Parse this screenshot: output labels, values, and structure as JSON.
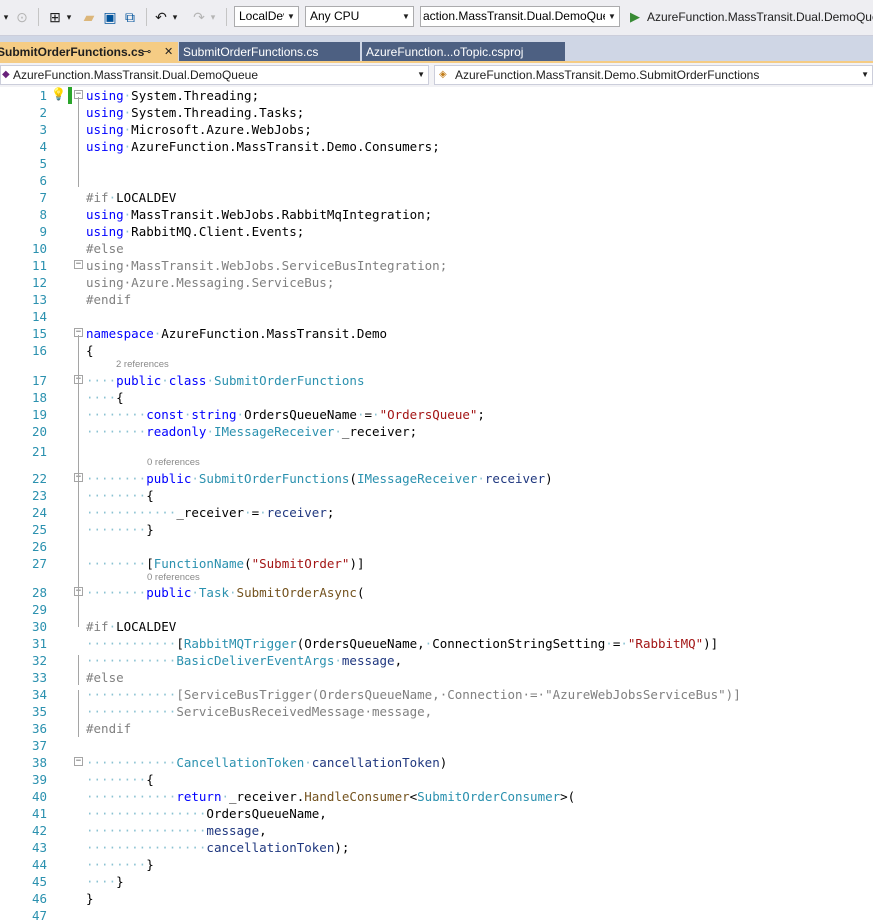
{
  "toolbar": {
    "config_value": "LocalDev",
    "platform_value": "Any CPU",
    "startup_project_value": "action.MassTransit.Dual.DemoQueue",
    "run_target_label": "AzureFunction.MassTransit.Dual.DemoQueue"
  },
  "tabs": [
    {
      "label": "SubmitOrderFunctions.cs",
      "pin": "⊸",
      "close": "✕"
    },
    {
      "label": "SubmitOrderFunctions.cs"
    },
    {
      "label": "AzureFunction...oTopic.csproj"
    }
  ],
  "navbar": {
    "project": "AzureFunction.MassTransit.Dual.DemoQueue",
    "type": "AzureFunction.MassTransit.Demo.SubmitOrderFunctions"
  },
  "lens": {
    "class_refs": "2 references",
    "ctor_refs": "0 references",
    "method_refs": "0 references"
  },
  "code_lines": [
    {
      "n": "1",
      "segs": [
        [
          "kw",
          "using"
        ],
        [
          "ws",
          "·"
        ],
        [
          "",
          "System.Threading;"
        ]
      ]
    },
    {
      "n": "2",
      "segs": [
        [
          "kw",
          "using"
        ],
        [
          "ws",
          "·"
        ],
        [
          "",
          "System.Threading.Tasks;"
        ]
      ]
    },
    {
      "n": "3",
      "segs": [
        [
          "kw",
          "using"
        ],
        [
          "ws",
          "·"
        ],
        [
          "",
          "Microsoft.Azure.WebJobs;"
        ]
      ]
    },
    {
      "n": "4",
      "segs": [
        [
          "kw",
          "using"
        ],
        [
          "ws",
          "·"
        ],
        [
          "",
          "AzureFunction.MassTransit.Demo.Consumers;"
        ]
      ]
    },
    {
      "n": "5",
      "segs": []
    },
    {
      "n": "6",
      "segs": []
    },
    {
      "n": "7",
      "segs": [
        [
          "pp",
          "#if"
        ],
        [
          "ws",
          "·"
        ],
        [
          "",
          "LOCALDEV"
        ]
      ]
    },
    {
      "n": "8",
      "segs": [
        [
          "kw",
          "using"
        ],
        [
          "ws",
          "·"
        ],
        [
          "",
          "MassTransit.WebJobs.RabbitMqIntegration;"
        ]
      ]
    },
    {
      "n": "9",
      "segs": [
        [
          "kw",
          "using"
        ],
        [
          "ws",
          "·"
        ],
        [
          "",
          "RabbitMQ.Client.Events;"
        ]
      ]
    },
    {
      "n": "10",
      "segs": [
        [
          "pp",
          "#else"
        ]
      ]
    },
    {
      "n": "11",
      "segs": [
        [
          "gr",
          "using·MassTransit.WebJobs.ServiceBusIntegration;"
        ]
      ]
    },
    {
      "n": "12",
      "segs": [
        [
          "gr",
          "using·Azure.Messaging.ServiceBus;"
        ]
      ]
    },
    {
      "n": "13",
      "segs": [
        [
          "pp",
          "#endif"
        ]
      ]
    },
    {
      "n": "14",
      "segs": []
    },
    {
      "n": "15",
      "segs": [
        [
          "kw",
          "namespace"
        ],
        [
          "ws",
          "·"
        ],
        [
          "",
          "AzureFunction.MassTransit.Demo"
        ]
      ]
    },
    {
      "n": "16",
      "segs": [
        [
          "",
          "{"
        ]
      ]
    },
    {
      "n": "17",
      "segs": [
        [
          "ws",
          "····"
        ],
        [
          "kw",
          "public"
        ],
        [
          "ws",
          "·"
        ],
        [
          "kw",
          "class"
        ],
        [
          "ws",
          "·"
        ],
        [
          "ty",
          "SubmitOrderFunctions"
        ]
      ]
    },
    {
      "n": "18",
      "segs": [
        [
          "ws",
          "····"
        ],
        [
          "",
          "{"
        ]
      ]
    },
    {
      "n": "19",
      "segs": [
        [
          "ws",
          "········"
        ],
        [
          "kw",
          "const"
        ],
        [
          "ws",
          "·"
        ],
        [
          "kw",
          "string"
        ],
        [
          "ws",
          "·"
        ],
        [
          "",
          "OrdersQueueName"
        ],
        [
          "ws",
          "·"
        ],
        [
          "",
          "="
        ],
        [
          "ws",
          "·"
        ],
        [
          "st",
          "\"OrdersQueue\""
        ],
        [
          "",
          ";"
        ]
      ]
    },
    {
      "n": "20",
      "segs": [
        [
          "ws",
          "········"
        ],
        [
          "kw",
          "readonly"
        ],
        [
          "ws",
          "·"
        ],
        [
          "ty",
          "IMessageReceiver"
        ],
        [
          "ws",
          "·"
        ],
        [
          "",
          "_receiver;"
        ]
      ]
    },
    {
      "n": "21",
      "segs": []
    },
    {
      "n": "22",
      "segs": [
        [
          "ws",
          "········"
        ],
        [
          "kw",
          "public"
        ],
        [
          "ws",
          "·"
        ],
        [
          "ty",
          "SubmitOrderFunctions"
        ],
        [
          "",
          "("
        ],
        [
          "ty",
          "IMessageReceiver"
        ],
        [
          "ws",
          "·"
        ],
        [
          "pa",
          "receiver"
        ],
        [
          "",
          ")"
        ]
      ]
    },
    {
      "n": "23",
      "segs": [
        [
          "ws",
          "········"
        ],
        [
          "",
          "{"
        ]
      ]
    },
    {
      "n": "24",
      "segs": [
        [
          "ws",
          "············"
        ],
        [
          "",
          "_receiver"
        ],
        [
          "ws",
          "·"
        ],
        [
          "",
          "="
        ],
        [
          "ws",
          "·"
        ],
        [
          "pa",
          "receiver"
        ],
        [
          "",
          ";"
        ]
      ]
    },
    {
      "n": "25",
      "segs": [
        [
          "ws",
          "········"
        ],
        [
          "",
          "}"
        ]
      ]
    },
    {
      "n": "26",
      "segs": []
    },
    {
      "n": "27",
      "segs": [
        [
          "ws",
          "········"
        ],
        [
          "",
          "["
        ],
        [
          "ty",
          "FunctionName"
        ],
        [
          "",
          "("
        ],
        [
          "st",
          "\"SubmitOrder\""
        ],
        [
          "",
          ")]"
        ]
      ]
    },
    {
      "n": "28",
      "segs": [
        [
          "ws",
          "········"
        ],
        [
          "kw",
          "public"
        ],
        [
          "ws",
          "·"
        ],
        [
          "ty",
          "Task"
        ],
        [
          "ws",
          "·"
        ],
        [
          "mt",
          "SubmitOrderAsync"
        ],
        [
          "",
          "("
        ]
      ]
    },
    {
      "n": "29",
      "segs": []
    },
    {
      "n": "30",
      "segs": [
        [
          "pp",
          "#if"
        ],
        [
          "ws",
          "·"
        ],
        [
          "",
          "LOCALDEV"
        ]
      ]
    },
    {
      "n": "31",
      "segs": [
        [
          "ws",
          "············"
        ],
        [
          "",
          "["
        ],
        [
          "ty",
          "RabbitMQTrigger"
        ],
        [
          "",
          "(OrdersQueueName,"
        ],
        [
          "ws",
          "·"
        ],
        [
          "",
          "ConnectionStringSetting"
        ],
        [
          "ws",
          "·"
        ],
        [
          "",
          "="
        ],
        [
          "ws",
          "·"
        ],
        [
          "st",
          "\"RabbitMQ\""
        ],
        [
          "",
          ")]"
        ]
      ]
    },
    {
      "n": "32",
      "segs": [
        [
          "ws",
          "············"
        ],
        [
          "ty",
          "BasicDeliverEventArgs"
        ],
        [
          "ws",
          "·"
        ],
        [
          "pa",
          "message"
        ],
        [
          "",
          ","
        ]
      ]
    },
    {
      "n": "33",
      "segs": [
        [
          "pp",
          "#else"
        ]
      ]
    },
    {
      "n": "34",
      "segs": [
        [
          "ws",
          "············"
        ],
        [
          "gr",
          "[ServiceBusTrigger(OrdersQueueName,·Connection·=·\"AzureWebJobsServiceBus\")]"
        ]
      ]
    },
    {
      "n": "35",
      "segs": [
        [
          "ws",
          "············"
        ],
        [
          "gr",
          "ServiceBusReceivedMessage·message,"
        ]
      ]
    },
    {
      "n": "36",
      "segs": [
        [
          "pp",
          "#endif"
        ]
      ]
    },
    {
      "n": "37",
      "segs": []
    },
    {
      "n": "38",
      "segs": [
        [
          "ws",
          "············"
        ],
        [
          "ty",
          "CancellationToken"
        ],
        [
          "ws",
          "·"
        ],
        [
          "pa",
          "cancellationToken"
        ],
        [
          "",
          ")"
        ]
      ]
    },
    {
      "n": "39",
      "segs": [
        [
          "ws",
          "········"
        ],
        [
          "",
          "{"
        ]
      ]
    },
    {
      "n": "40",
      "segs": [
        [
          "ws",
          "············"
        ],
        [
          "kw",
          "return"
        ],
        [
          "ws",
          "·"
        ],
        [
          "",
          "_receiver."
        ],
        [
          "mt",
          "HandleConsumer"
        ],
        [
          "",
          "<"
        ],
        [
          "ty",
          "SubmitOrderConsumer"
        ],
        [
          "",
          ">("
        ]
      ]
    },
    {
      "n": "41",
      "segs": [
        [
          "ws",
          "················"
        ],
        [
          "",
          "OrdersQueueName,"
        ]
      ]
    },
    {
      "n": "42",
      "segs": [
        [
          "ws",
          "················"
        ],
        [
          "pa",
          "message"
        ],
        [
          "",
          ","
        ]
      ]
    },
    {
      "n": "43",
      "segs": [
        [
          "ws",
          "················"
        ],
        [
          "pa",
          "cancellationToken"
        ],
        [
          "",
          ");"
        ]
      ]
    },
    {
      "n": "44",
      "segs": [
        [
          "ws",
          "········"
        ],
        [
          "",
          "}"
        ]
      ]
    },
    {
      "n": "45",
      "segs": [
        [
          "ws",
          "····"
        ],
        [
          "",
          "}"
        ]
      ]
    },
    {
      "n": "46",
      "segs": [
        [
          "",
          "}"
        ]
      ]
    },
    {
      "n": "47",
      "segs": []
    }
  ]
}
